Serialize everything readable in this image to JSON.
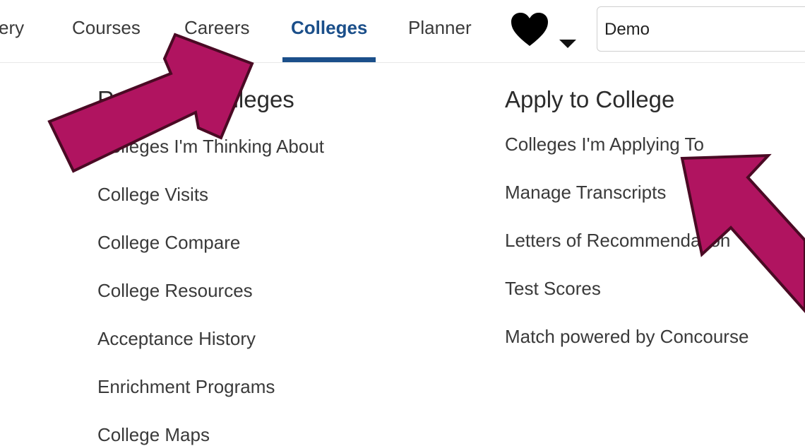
{
  "nav": {
    "items": [
      {
        "label": "ery"
      },
      {
        "label": "Courses"
      },
      {
        "label": "Careers"
      },
      {
        "label": "Colleges"
      },
      {
        "label": "Planner"
      }
    ],
    "active": "Colleges",
    "user_menu_label": "Demo"
  },
  "left_column": {
    "heading": "Research Colleges",
    "links": [
      {
        "label": "Colleges I'm Thinking About"
      },
      {
        "label": "College Visits"
      },
      {
        "label": "College Compare"
      },
      {
        "label": "College Resources"
      },
      {
        "label": "Acceptance History"
      },
      {
        "label": "Enrichment Programs"
      },
      {
        "label": "College Maps"
      }
    ]
  },
  "right_column": {
    "heading": "Apply to College",
    "links": [
      {
        "label": "Colleges I'm Applying To"
      },
      {
        "label": "Manage Transcripts"
      },
      {
        "label": "Letters of Recommendation"
      },
      {
        "label": "Test Scores"
      },
      {
        "label": "Match powered by Concourse"
      }
    ]
  },
  "colors": {
    "accent": "#1b4f8a",
    "arrow_fill": "#b01460",
    "arrow_stroke": "#4a0a24"
  },
  "icons": {
    "favorites": "heart-icon",
    "dropdown": "caret-down-icon"
  }
}
